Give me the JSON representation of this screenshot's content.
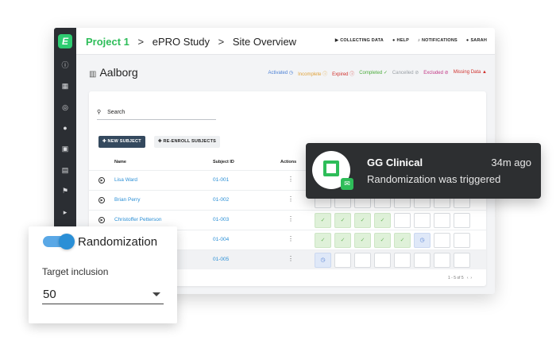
{
  "breadcrumb": {
    "project": "Project 1",
    "sep": ">",
    "study": "ePRO Study",
    "page": "Site Overview"
  },
  "topnav": [
    "COLLECTING DATA",
    "HELP",
    "NOTIFICATIONS",
    "SARAH"
  ],
  "site": {
    "name": "Aalborg"
  },
  "legend": [
    {
      "label": "Activated",
      "color": "#4a7fd4"
    },
    {
      "label": "Incomplete",
      "color": "#e0a23a"
    },
    {
      "label": "Expired",
      "color": "#d0312d"
    },
    {
      "label": "Completed",
      "color": "#4bab3c"
    },
    {
      "label": "Cancelled",
      "color": "#9aa0a6"
    },
    {
      "label": "Excluded",
      "color": "#c13584"
    },
    {
      "label": "Missing Data",
      "color": "#d0312d"
    }
  ],
  "search": {
    "label": "Search"
  },
  "buttons": {
    "new_subject": "NEW SUBJECT",
    "reenroll": "RE-ENROLL SUBJECTS"
  },
  "table": {
    "headers": {
      "name": "Name",
      "subject_id": "Subject ID",
      "actions": "Actions"
    },
    "rows": [
      {
        "name": "Lisa Ward",
        "id": "01-001",
        "cells": [
          "",
          "",
          "",
          "",
          "",
          "",
          "",
          ""
        ]
      },
      {
        "name": "Brian Perry",
        "id": "01-002",
        "cells": [
          "",
          "",
          "",
          "",
          "",
          "",
          "",
          ""
        ]
      },
      {
        "name": "Christoffer Petterson",
        "id": "01-003",
        "cells": [
          "g",
          "g",
          "g",
          "g",
          "",
          "",
          "",
          ""
        ]
      },
      {
        "name": "",
        "id": "01-004",
        "cells": [
          "g",
          "g",
          "g",
          "g",
          "g",
          "b",
          "",
          ""
        ]
      },
      {
        "name": "",
        "id": "01-005",
        "cells": [
          "b",
          "",
          "",
          "",
          "",
          "",
          "",
          ""
        ]
      }
    ],
    "pager": "1 - 5 of 5"
  },
  "notification": {
    "sender": "GG Clinical",
    "time": "34m ago",
    "message": "Randomization was triggered"
  },
  "randomization": {
    "label": "Randomization",
    "enabled": true,
    "target_label": "Target inclusion",
    "target_value": "50"
  }
}
